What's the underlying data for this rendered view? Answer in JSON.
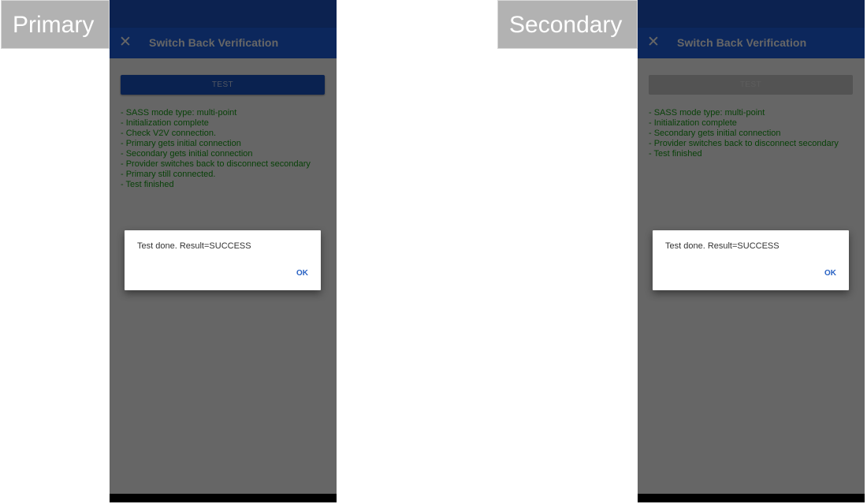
{
  "labels": {
    "primary": "Primary",
    "secondary": "Secondary"
  },
  "colors": {
    "status_bar": "#1e55c8",
    "app_bar": "#1e63e6",
    "log_text": "#17a317",
    "dialog_button": "#2a63c4"
  },
  "primary": {
    "app_title": "Switch Back Verification",
    "close_icon": "close-icon",
    "test_button": "TEST",
    "test_button_enabled": true,
    "log": [
      "- SASS mode type: multi-point",
      "- Initialization complete",
      "- Check V2V connection.",
      "- Primary gets initial connection",
      "- Secondary gets initial connection",
      "- Provider switches back to disconnect secondary",
      "- Primary still connected.",
      "- Test finished"
    ],
    "dialog": {
      "message": "Test done. Result=SUCCESS",
      "ok_label": "OK"
    }
  },
  "secondary": {
    "app_title": "Switch Back Verification",
    "close_icon": "close-icon",
    "test_button": "TEST",
    "test_button_enabled": false,
    "log": [
      "- SASS mode type: multi-point",
      "- Initialization complete",
      "- Secondary gets initial connection",
      "- Provider switches back to disconnect secondary",
      "- Test finished"
    ],
    "dialog": {
      "message": "Test done. Result=SUCCESS",
      "ok_label": "OK"
    }
  }
}
